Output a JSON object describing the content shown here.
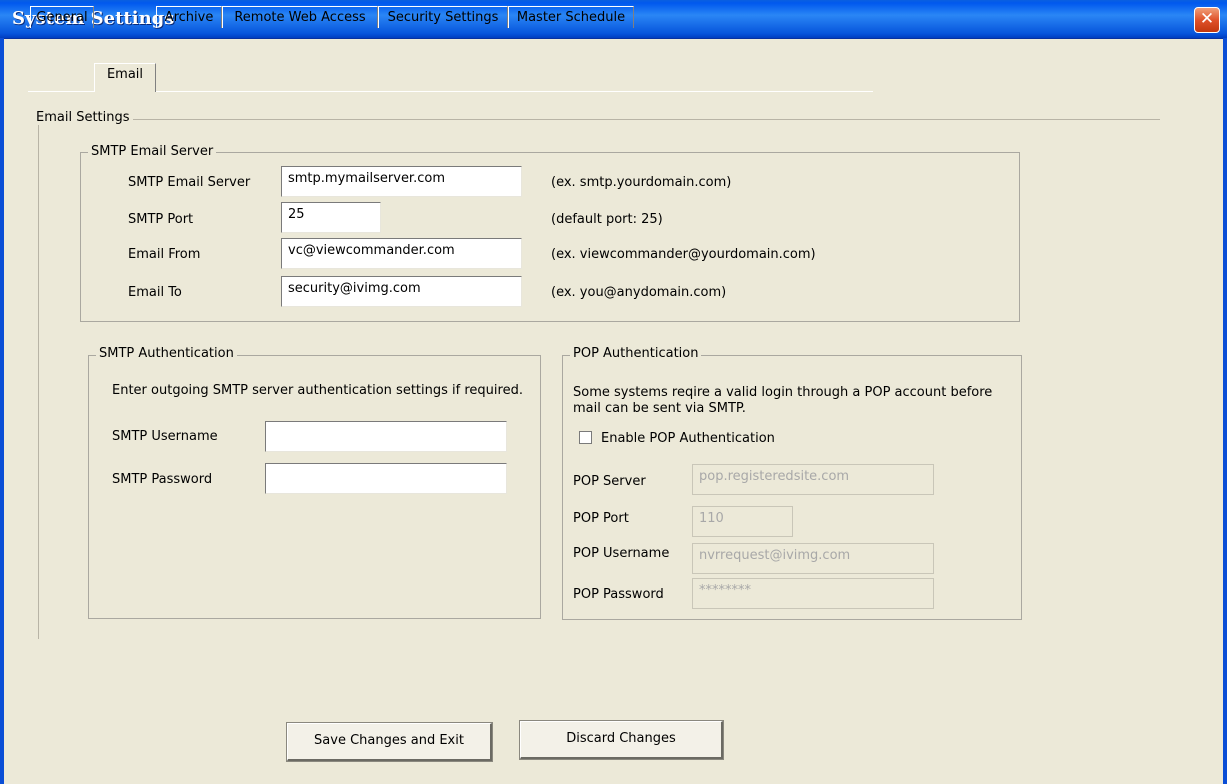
{
  "window": {
    "title": "System Settings",
    "close_glyph": "✕"
  },
  "tabs": [
    {
      "label": "General"
    },
    {
      "label": "Email",
      "selected": true
    },
    {
      "label": "Archive"
    },
    {
      "label": "Remote Web Access"
    },
    {
      "label": "Security Settings"
    },
    {
      "label": "Master Schedule"
    }
  ],
  "email_settings": {
    "group_label": "Email Settings",
    "smtp_server": {
      "group_label": "SMTP Email Server",
      "server_label": "SMTP Email Server",
      "server_value": "smtp.mymailserver.com",
      "server_hint": "(ex. smtp.yourdomain.com)",
      "port_label": "SMTP Port",
      "port_value": "25",
      "port_hint": "(default port: 25)",
      "from_label": "Email From",
      "from_value": "vc@viewcommander.com",
      "from_hint": "(ex. viewcommander@yourdomain.com)",
      "to_label": "Email To",
      "to_value": "security@ivimg.com",
      "to_hint": "(ex. you@anydomain.com)"
    },
    "smtp_auth": {
      "group_label": "SMTP Authentication",
      "description": "Enter outgoing SMTP server authentication settings if required.",
      "username_label": "SMTP Username",
      "username_value": "",
      "password_label": "SMTP Password",
      "password_value": ""
    },
    "pop_auth": {
      "group_label": "POP Authentication",
      "description_line1": "Some systems reqire a valid login through a POP account before",
      "description_line2": "mail can be sent via SMTP.",
      "enable_label": "Enable POP Authentication",
      "enable_checked": false,
      "server_label": "POP Server",
      "server_value": "pop.registeredsite.com",
      "port_label": "POP Port",
      "port_value": "110",
      "username_label": "POP Username",
      "username_value": "nvrrequest@ivimg.com",
      "password_label": "POP Password",
      "password_value": "********"
    }
  },
  "buttons": {
    "save_label": "Save Changes and Exit",
    "discard_label": "Discard Changes"
  },
  "colors": {
    "titlebar": "#0058ee",
    "background": "#ece9d8",
    "close": "#e0522a"
  }
}
